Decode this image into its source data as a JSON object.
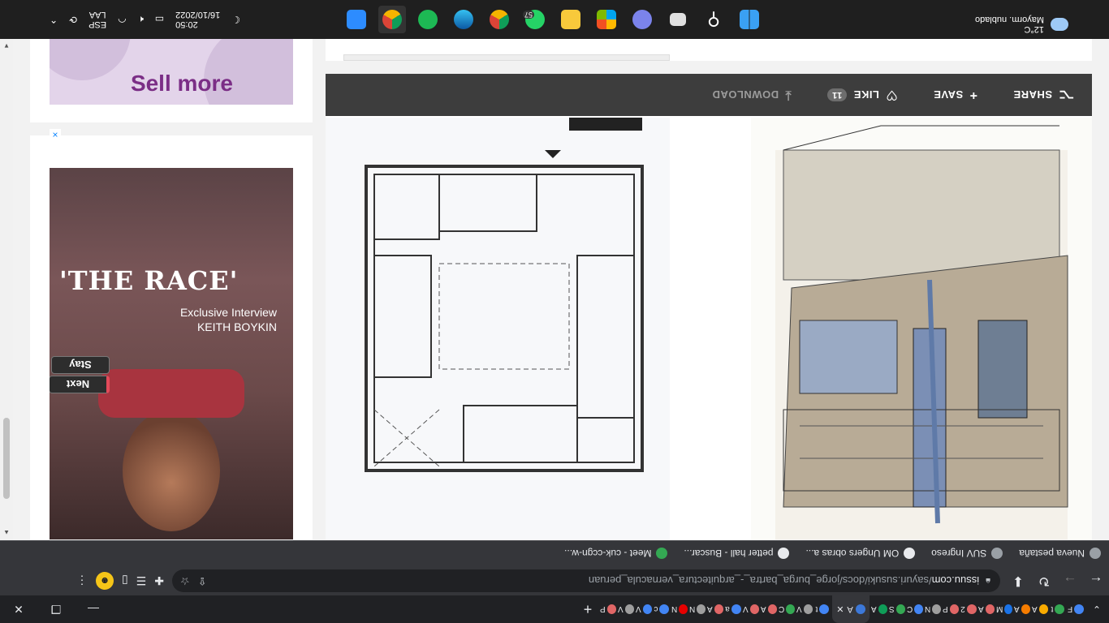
{
  "tabs": {
    "items": [
      {
        "label": "F",
        "color": "#4285f4"
      },
      {
        "label": "t",
        "color": "#34a853"
      },
      {
        "label": "A",
        "color": "#f9ab00"
      },
      {
        "label": "A",
        "color": "#f57c00"
      },
      {
        "label": "M",
        "color": "#1a73e8"
      },
      {
        "label": "A",
        "color": "#e06666"
      },
      {
        "label": "2",
        "color": "#e06666"
      },
      {
        "label": "P",
        "color": "#e06666"
      },
      {
        "label": "N",
        "color": "#9e9e9e"
      },
      {
        "label": "C",
        "color": "#4285f4"
      },
      {
        "label": "S",
        "color": "#34a853"
      },
      {
        "label": "A",
        "color": "#0f9d58"
      }
    ],
    "active_label": "A",
    "after": [
      {
        "label": "t",
        "color": "#4285f4"
      },
      {
        "label": "V",
        "color": "#9e9e9e"
      },
      {
        "label": "C",
        "color": "#34a853"
      },
      {
        "label": "A",
        "color": "#e06666"
      },
      {
        "label": "V",
        "color": "#e06666"
      },
      {
        "label": "a",
        "color": "#4285f4"
      },
      {
        "label": "A",
        "color": "#e06666"
      },
      {
        "label": "N",
        "color": "#9e9e9e"
      },
      {
        "label": "N",
        "color": "#e60000"
      },
      {
        "label": "c",
        "color": "#4285f4"
      },
      {
        "label": "V",
        "color": "#4285f4"
      },
      {
        "label": "V",
        "color": "#9e9e9e"
      },
      {
        "label": "P",
        "color": "#e06666"
      }
    ]
  },
  "omnibox": {
    "domain": "issuu.com",
    "path": "/sayuri.susuki/docs/jorge_burga_bartra_-_arquitectura_vernacula_peruan"
  },
  "bookmarks": [
    {
      "label": "Nueva pestaña",
      "color": "#9aa0a6"
    },
    {
      "label": "SUV Ingreso",
      "color": "#9aa0a6"
    },
    {
      "label": "OM Ungers obras a...",
      "color": "#e8eaed"
    },
    {
      "label": "petter hall - Buscar...",
      "color": "#e8eaed"
    },
    {
      "label": "Meet - cuk-ccgn-w...",
      "color": "#34a853"
    }
  ],
  "reader_bar": {
    "share": "SHARE",
    "save": "SAVE",
    "like": "LIKE",
    "like_count": "11",
    "download": "DOWNLOAD"
  },
  "video_ad": {
    "title": "'THE RACE'",
    "subtitle1": "Exclusive Interview",
    "subtitle2": "KEITH BOYKIN",
    "next": "Next",
    "stay": "Stay"
  },
  "banner_ad": {
    "text": "Sell more",
    "close": "×"
  },
  "taskbar": {
    "weather_temp": "12°C",
    "weather_desc": "Mayorm. nublado",
    "lang1": "ESP",
    "lang2": "LAA",
    "time": "20:50",
    "date": "16/10/2022",
    "badge": "57"
  }
}
